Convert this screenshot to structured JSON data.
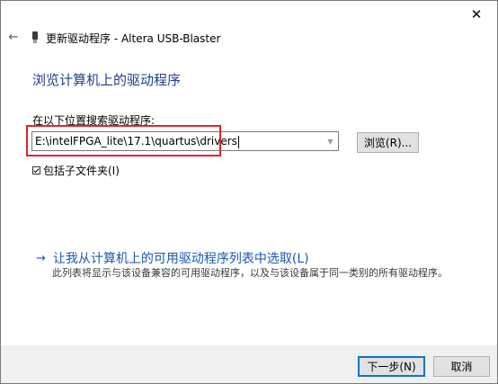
{
  "window": {
    "title": "更新驱动程序 - Altera USB-Blaster",
    "close_glyph": "✕",
    "back_glyph": "←"
  },
  "main": {
    "heading": "浏览计算机上的驱动程序",
    "search_label": "在以下位置搜索驱动程序:",
    "path_value": "E:\\intelFPGA_lite\\17.1\\quartus\\drivers",
    "browse_label": "浏览(R)...",
    "include_subfolders_label": "包括子文件夹(I)",
    "include_subfolders_checked": true
  },
  "pick_option": {
    "arrow_glyph": "→",
    "link_label": "让我从计算机上的可用驱动程序列表中选取(L)",
    "description": "此列表将显示与该设备兼容的可用驱动程序，以及与该设备属于同一类别的所有驱动程序。"
  },
  "footer": {
    "next_label": "下一步(N)",
    "cancel_label": "取消"
  },
  "colors": {
    "heading": "#1f3e8c",
    "link": "#1a56b6",
    "highlight": "#e0242b",
    "default_button_border": "#0078d7"
  }
}
